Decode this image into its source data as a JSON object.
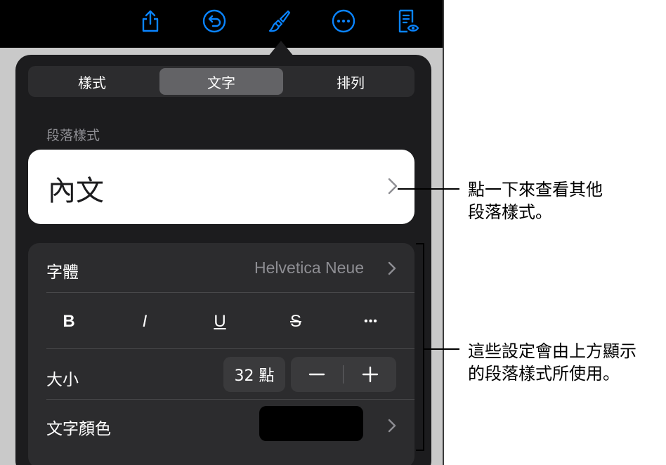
{
  "toolbar": {
    "icons": [
      "share-icon",
      "undo-icon",
      "format-brush-icon",
      "more-icon",
      "reading-view-icon"
    ],
    "icon_color": "#0a84ff"
  },
  "popover": {
    "tabs": [
      {
        "label": "樣式",
        "active": false
      },
      {
        "label": "文字",
        "active": true
      },
      {
        "label": "排列",
        "active": false
      }
    ],
    "section_label": "段落樣式",
    "paragraph_style": "內文",
    "font": {
      "label": "字體",
      "value": "Helvetica Neue"
    },
    "format_buttons": {
      "bold": "B",
      "italic": "I",
      "underline": "U",
      "strike": "S",
      "more": "•••"
    },
    "size": {
      "label": "大小",
      "value": "32 點",
      "decrease": "−",
      "increase": "+"
    },
    "text_color": {
      "label": "文字顏色",
      "swatch": "#000000"
    }
  },
  "callouts": {
    "style_line1": "點一下來查看其他",
    "style_line2": "段落樣式。",
    "settings_line1": "這些設定會由上方顯示",
    "settings_line2": "的段落樣式所使用。"
  }
}
